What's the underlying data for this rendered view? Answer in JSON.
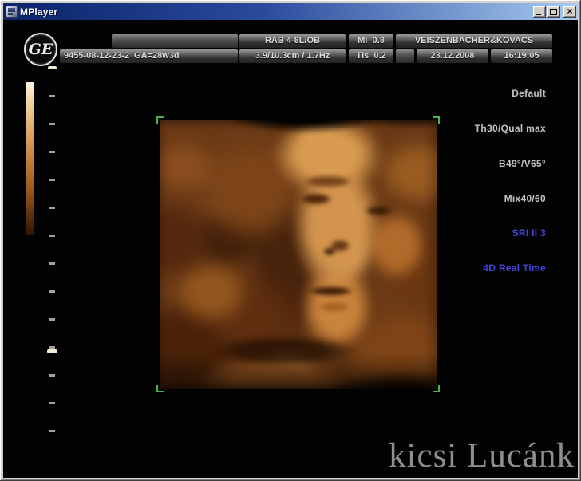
{
  "window": {
    "title": "MPlayer",
    "controls": {
      "close_glyph": "×"
    }
  },
  "ultrasound": {
    "header": {
      "probe": "RAB 4-8L/OB",
      "mi": "MI  0.8",
      "patient": "VEISZENBACHER&KOVACS",
      "patient_id": "9455-08-12-23-2  GA=28w3d",
      "scan_params": "3.9/10.3cm / 1.7Hz",
      "tis": "TIs  0.2",
      "date": "23.12.2008",
      "time": "16:19:05"
    },
    "settings": [
      "Default",
      "Th30/Qual max",
      "B49°/V65°",
      "Mix40/60",
      "SRI II 3",
      "4D Real Time"
    ],
    "ge_monogram": "GE",
    "caption": "kicsi Lucánk"
  },
  "colors": {
    "settings_text": "#c2c2c2",
    "settings_accent_blue": "#4444e0",
    "corner_marker_green": "#49b34c",
    "colormap_top": "#fcf6e4",
    "colormap_mid": "#c07c33",
    "colormap_bottom": "#2a1404",
    "titlebar_left": "#0a246a",
    "titlebar_right": "#a6caf0"
  }
}
